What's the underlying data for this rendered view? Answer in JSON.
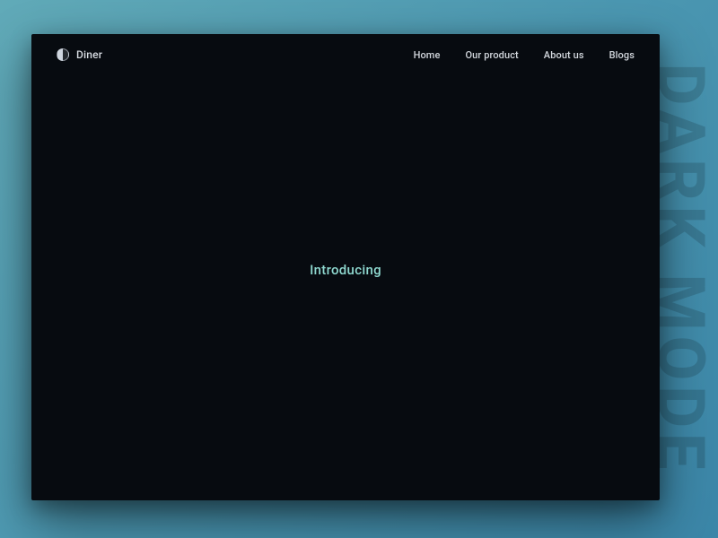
{
  "brand": {
    "name": "Diner"
  },
  "nav": {
    "links": [
      "Home",
      "Our product",
      "About us",
      "Blogs"
    ]
  },
  "hero": {
    "text": "Introducing"
  },
  "background": {
    "side_label": "DARK MODE"
  },
  "colors": {
    "window_bg": "#070b10",
    "accent_text": "#8fd9d0",
    "nav_text": "#d3d8de",
    "gradient_start": "#61aab8",
    "gradient_end": "#3b86a8"
  }
}
